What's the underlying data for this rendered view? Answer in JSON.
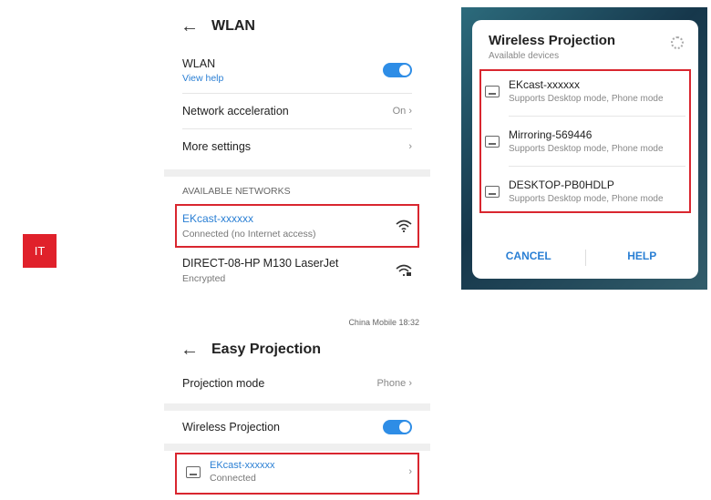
{
  "side_tab": {
    "label": "IT"
  },
  "wlan": {
    "title": "WLAN",
    "wlan_toggle": {
      "label": "WLAN",
      "help": "View help",
      "on": true
    },
    "acceleration": {
      "label": "Network acceleration",
      "value": "On"
    },
    "more_settings": {
      "label": "More settings"
    },
    "section": "AVAILABLE NETWORKS",
    "networks": [
      {
        "name": "EKcast-xxxxxx",
        "status": "Connected (no Internet access)",
        "highlight": true
      },
      {
        "name": "DIRECT-08-HP M130 LaserJet",
        "status": "Encrypted",
        "highlight": false
      }
    ]
  },
  "dialog": {
    "title": "Wireless Projection",
    "subtitle": "Available devices",
    "devices": [
      {
        "name": "EKcast-xxxxxx",
        "desc": "Supports Desktop mode, Phone mode",
        "highlight": true
      },
      {
        "name": "Mirroring-569446",
        "desc": "Supports Desktop mode, Phone mode",
        "highlight": false
      },
      {
        "name": "DESKTOP-PB0HDLP",
        "desc": "Supports Desktop mode, Phone mode",
        "highlight": false
      }
    ],
    "cancel": "CANCEL",
    "help": "HELP"
  },
  "projection": {
    "status_bar": "China Mobile 18:32",
    "title": "Easy Projection",
    "mode": {
      "label": "Projection mode",
      "value": "Phone"
    },
    "wireless": {
      "label": "Wireless Projection",
      "on": true
    },
    "connected_device": {
      "name": "EKcast-xxxxxx",
      "status": "Connected"
    }
  },
  "colors": {
    "accent": "#2e8de6",
    "highlight": "#d9262f",
    "tab": "#e0212b"
  }
}
